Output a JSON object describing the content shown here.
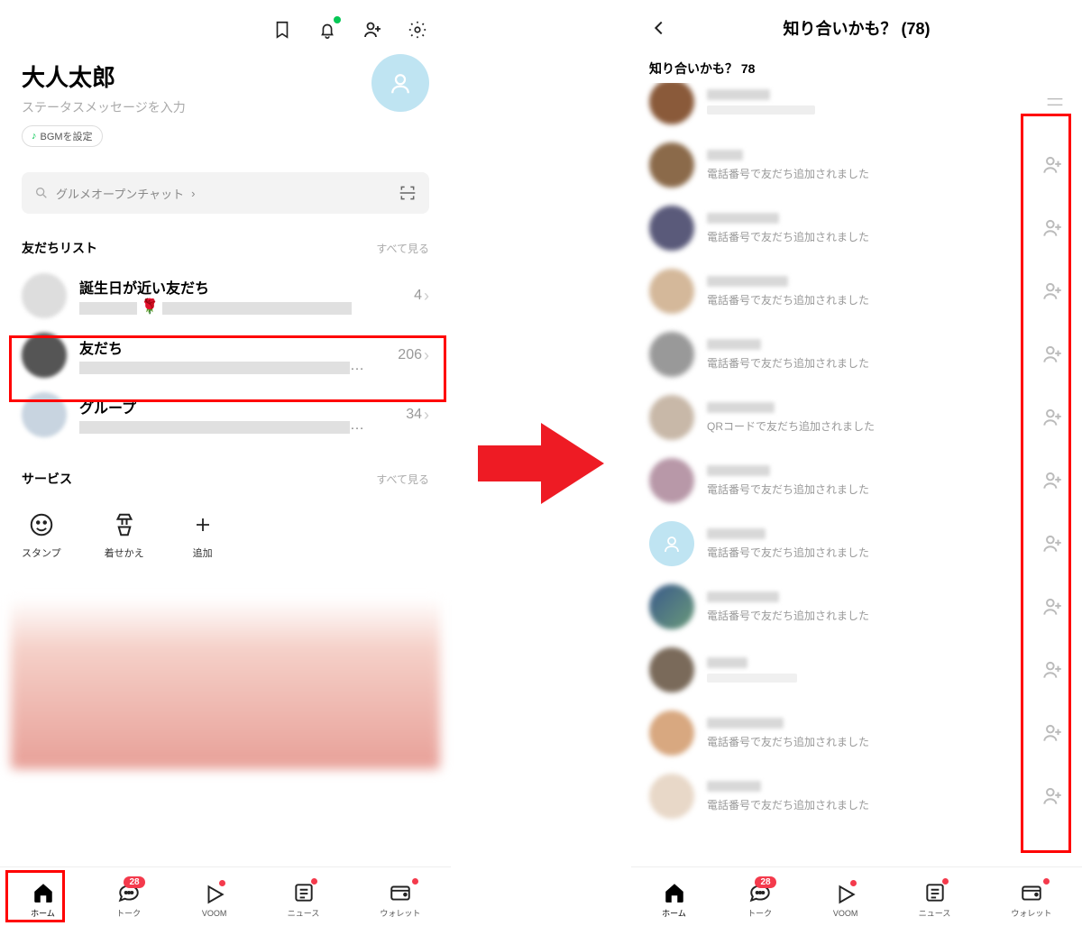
{
  "left": {
    "profile": {
      "name": "大人太郎",
      "status": "ステータスメッセージを入力",
      "bgm": "BGMを設定"
    },
    "search": {
      "placeholder": "グルメオープンチャット"
    },
    "friends_section": {
      "title": "友だちリスト",
      "see_all": "すべて見る"
    },
    "list": {
      "birthday": {
        "title": "誕生日が近い友だち",
        "count": "4"
      },
      "friends": {
        "title": "友だち",
        "count": "206"
      },
      "groups": {
        "title": "グループ",
        "count": "34"
      }
    },
    "services_section": {
      "title": "サービス",
      "see_all": "すべて見る"
    },
    "services": {
      "stamp": "スタンプ",
      "theme": "着せかえ",
      "add": "追加"
    }
  },
  "right": {
    "header": "知り合いかも？ (78)",
    "subheader": "知り合いかも？ 78",
    "via_phone": "電話番号で友だち追加されました",
    "via_qr": "QRコードで友だち追加されました"
  },
  "nav": {
    "home": "ホーム",
    "talk": "トーク",
    "voom": "VOOM",
    "news": "ニュース",
    "wallet": "ウォレット",
    "talk_badge": "28"
  }
}
